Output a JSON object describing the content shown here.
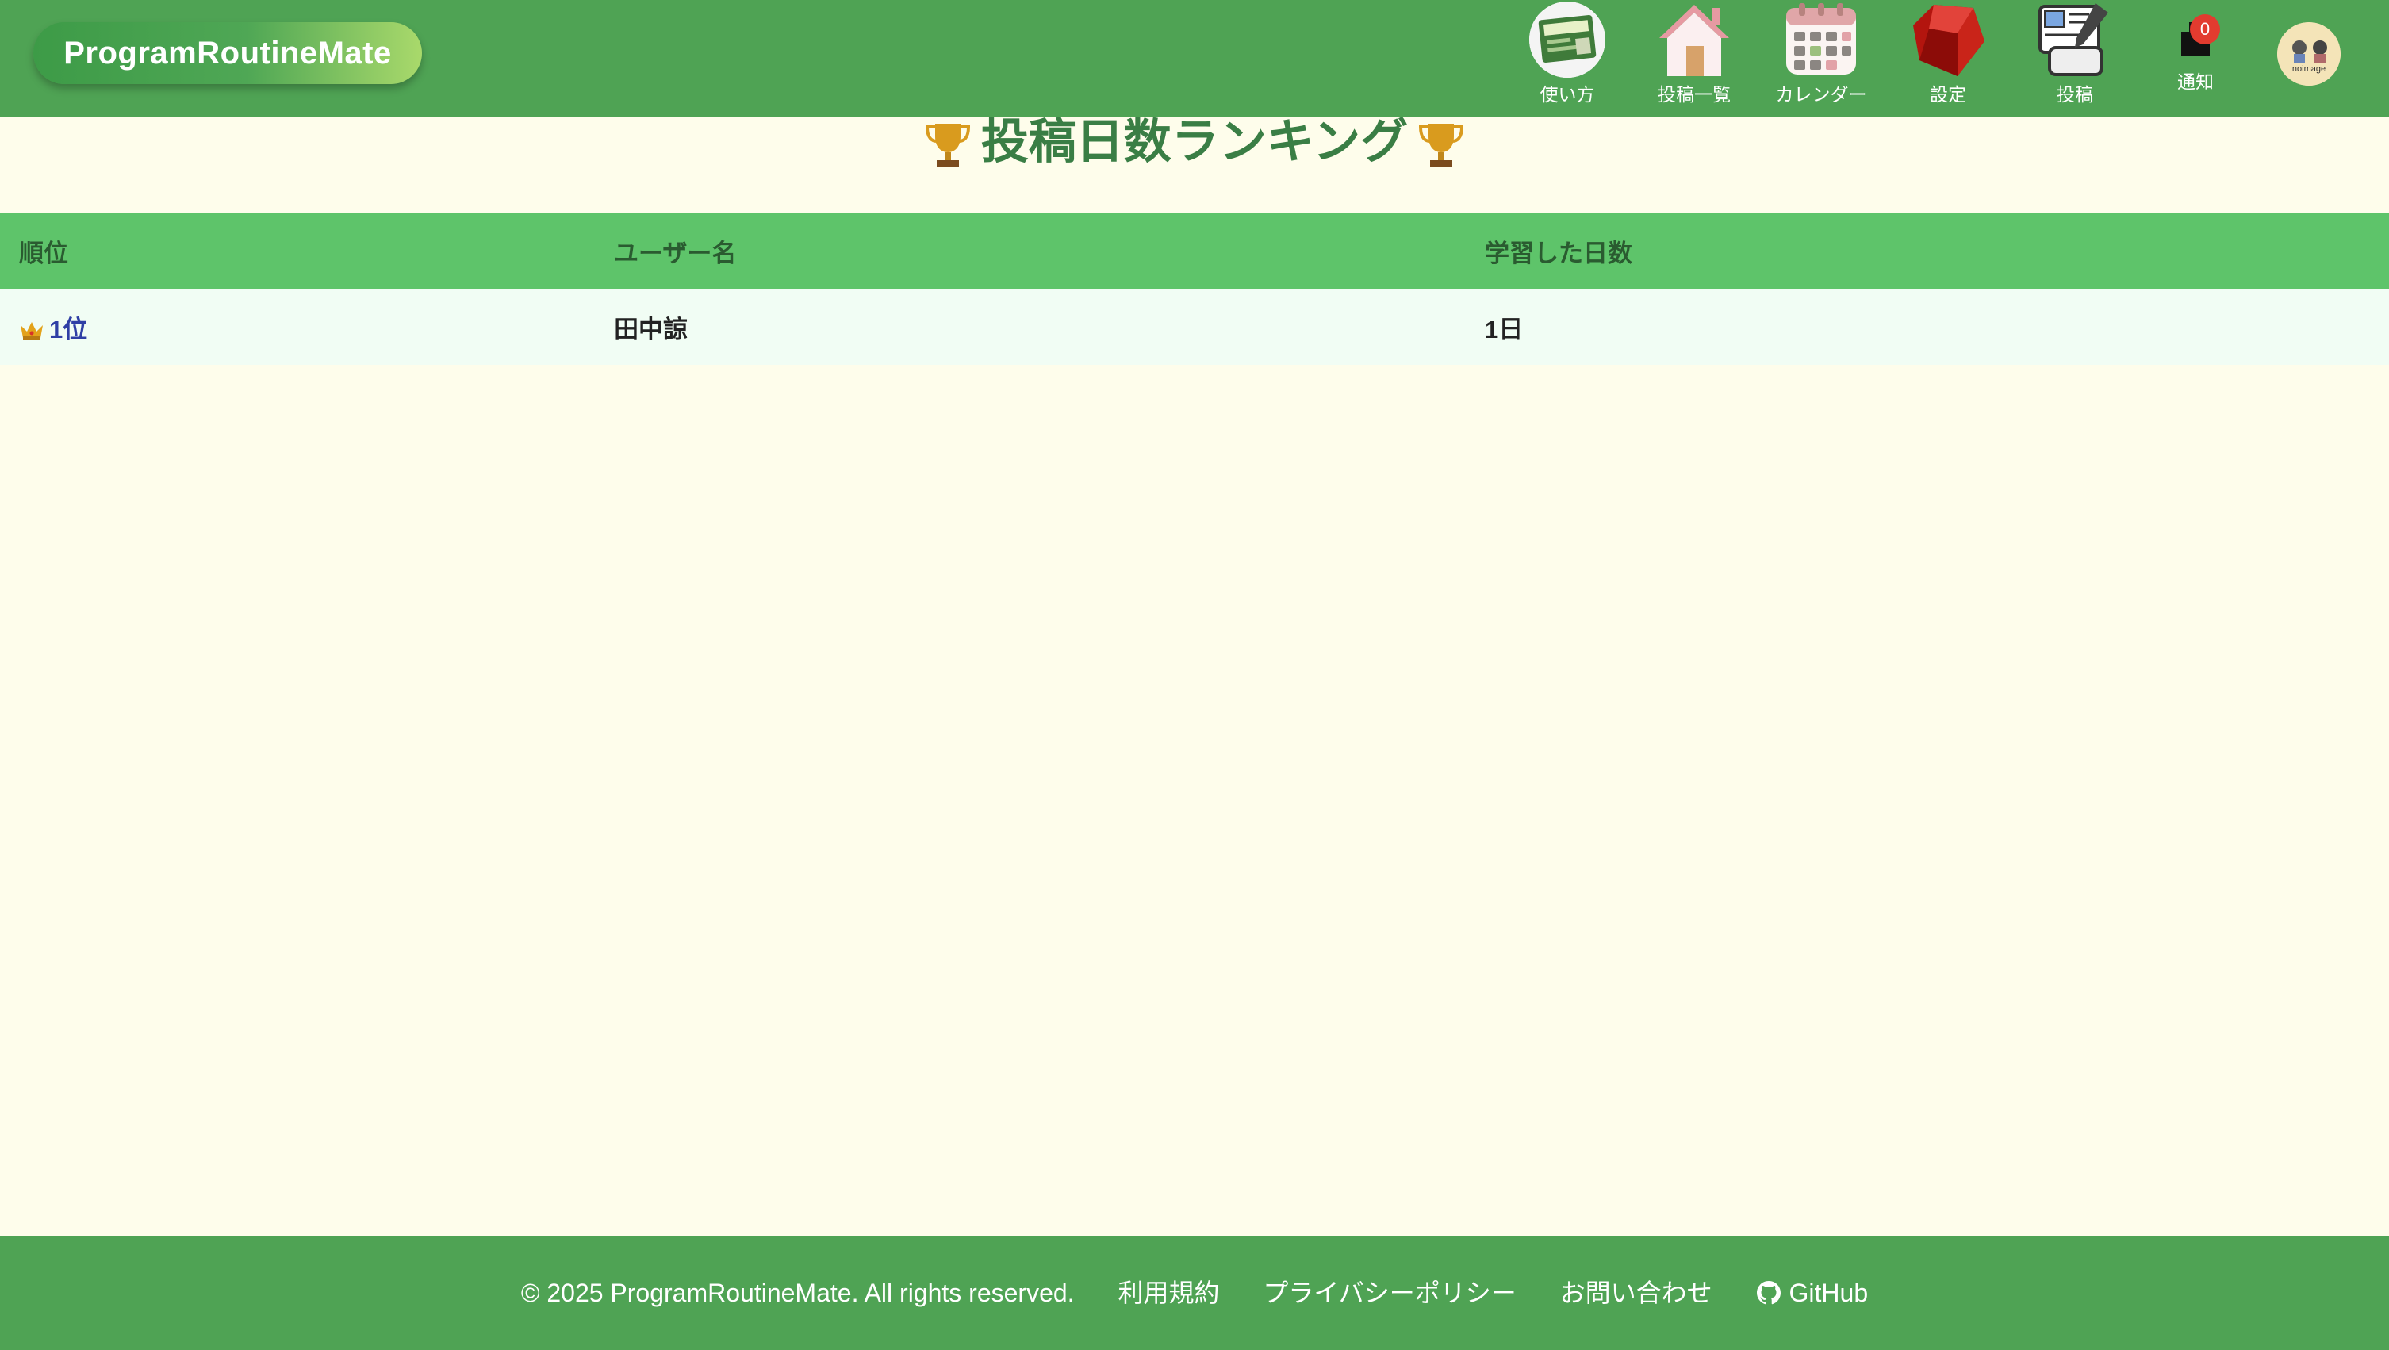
{
  "header": {
    "logo": "ProgramRoutineMate",
    "nav": [
      {
        "label": "使い方",
        "icon": "guide-book-icon"
      },
      {
        "label": "投稿一覧",
        "icon": "home-icon"
      },
      {
        "label": "カレンダー",
        "icon": "calendar-icon"
      },
      {
        "label": "設定",
        "icon": "ruby-gem-icon"
      },
      {
        "label": "投稿",
        "icon": "edit-post-icon"
      },
      {
        "label": "通知",
        "icon": "bell-icon"
      }
    ],
    "notification_count": "0",
    "avatar_text": "noimage"
  },
  "page": {
    "title": "投稿日数ランキング"
  },
  "table": {
    "headers": [
      "順位",
      "ユーザー名",
      "学習した日数"
    ],
    "rows": [
      {
        "rank": "1位",
        "user": "田中諒",
        "days": "1日"
      }
    ]
  },
  "footer": {
    "copyright": "© 2025 ProgramRoutineMate. All rights reserved.",
    "links": [
      "利用規約",
      "プライバシーポリシー",
      "お問い合わせ",
      "GitHub"
    ]
  },
  "colors": {
    "header_bg": "#4fa354",
    "page_bg": "#fefdeb",
    "table_header_bg": "#5ec46a",
    "row_bg": "#f1fdf4",
    "title_color": "#3a7e45",
    "rank_color": "#2f3fa5",
    "badge": "#e23b2f"
  }
}
